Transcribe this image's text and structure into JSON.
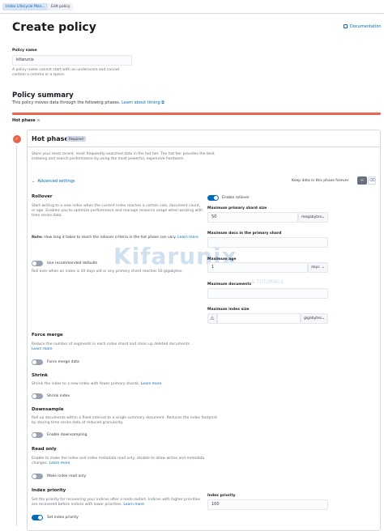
{
  "breadcrumbs": [
    "Index Lifecycle Man...",
    "Edit policy"
  ],
  "page": {
    "title": "Create policy",
    "documentation": "Documentation"
  },
  "policy_name": {
    "label": "Policy name",
    "value": "kifarunix",
    "help": "A policy name cannot start with an underscore and cannot contain a comma or a space."
  },
  "summary": {
    "title": "Policy summary",
    "description": "This policy moves data through the following phases.",
    "learn_more": "Learn about timing",
    "hot_phase_label": "Hot phase"
  },
  "hot_phase": {
    "title": "Hot phase",
    "badge": "Required",
    "description": "Store your most recent, most frequently-searched data in the hot tier. The hot tier provides the best indexing and search performance by using the most powerful, expensive hardware.",
    "advanced_settings": "Advanced settings",
    "keep_data": "Keep data in this phase forever"
  },
  "rollover": {
    "title": "Rollover",
    "description": "Start writing to a new index when the current index reaches a certain size, document count, or age. Enables you to optimize performance and manage resource usage when working with time series data.",
    "note_label": "Note:",
    "note": "How long it takes to reach the rollover criteria in the hot phase can vary.",
    "learn_more": "Learn more",
    "recommended_toggle": "Use recommended defaults",
    "recommended_on": false,
    "recommended_help": "Roll over when an index is 30 days old or any primary shard reaches 50 gigabytes.",
    "enable_toggle": "Enable rollover",
    "enable_on": true,
    "max_primary_shard_size": {
      "label": "Maximum primary shard size",
      "value": "50",
      "unit": "megabytes"
    },
    "max_docs_primary_shard": {
      "label": "Maximum docs in the primary shard",
      "value": ""
    },
    "max_age": {
      "label": "Maximum age",
      "value": "1",
      "unit": "days"
    },
    "max_documents": {
      "label": "Maximum documents",
      "value": ""
    },
    "max_index_size": {
      "label": "Maximum index size",
      "value": "",
      "unit": "gigabytes"
    }
  },
  "force_merge": {
    "title": "Force merge",
    "description": "Reduce the number of segments in each index shard and clean up deleted documents.",
    "learn_more": "Learn more",
    "toggle": "Force merge data",
    "on": false
  },
  "shrink": {
    "title": "Shrink",
    "description": "Shrink the index to a new index with fewer primary shards.",
    "learn_more": "Learn more",
    "toggle": "Shrink index",
    "on": false
  },
  "downsample": {
    "title": "Downsample",
    "description": "Roll up documents within a fixed interval to a single summary document. Reduces the index footprint by storing time series data at reduced granularity.",
    "toggle": "Enable downsampling",
    "on": false
  },
  "read_only": {
    "title": "Read only",
    "description": "Enable to make the index and index metadata read only, disable to allow writes and metadata changes.",
    "learn_more": "Learn more",
    "toggle": "Make index read only",
    "on": false
  },
  "index_priority": {
    "title": "Index priority",
    "description": "Set the priority for recovering your indices after a node restart. Indices with higher priorities are recovered before indices with lower priorities.",
    "learn_more": "Learn more",
    "toggle": "Set index priority",
    "on": true,
    "field_label": "Index priority",
    "value": "100"
  },
  "watermark": {
    "text": "Kifarunix",
    "sub": "& TUTORIALS"
  },
  "colors": {
    "accent": "#006bb8",
    "hot": "#e7664c"
  }
}
